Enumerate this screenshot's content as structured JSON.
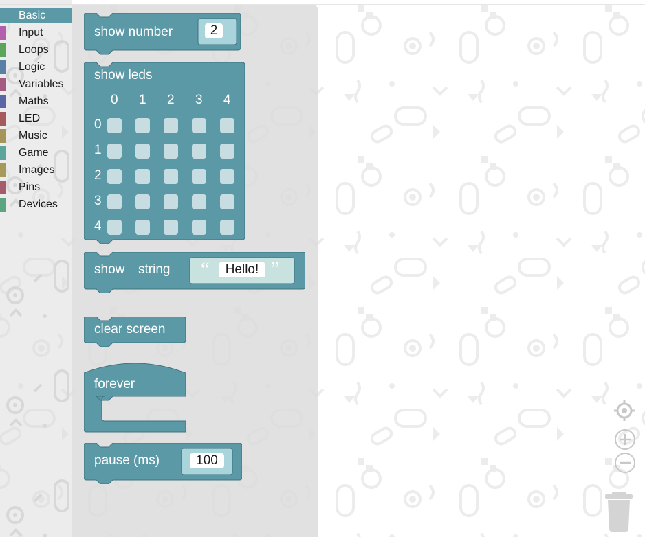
{
  "toolbox": {
    "categories": [
      {
        "label": "Basic",
        "color": "#5b99a6",
        "selected": true
      },
      {
        "label": "Input",
        "color": "#b45fab"
      },
      {
        "label": "Loops",
        "color": "#5ca55b"
      },
      {
        "label": "Logic",
        "color": "#5b80a5"
      },
      {
        "label": "Variables",
        "color": "#a55b80"
      },
      {
        "label": "Maths",
        "color": "#5b67a5"
      },
      {
        "label": "LED",
        "color": "#a55b5b"
      },
      {
        "label": "Music",
        "color": "#a5955b"
      },
      {
        "label": "Game",
        "color": "#5ba59b"
      },
      {
        "label": "Images",
        "color": "#a5995b"
      },
      {
        "label": "Pins",
        "color": "#a55b6a"
      },
      {
        "label": "Devices",
        "color": "#5ba57f"
      }
    ]
  },
  "blocks": {
    "show_number": {
      "label": "show number",
      "value": "2"
    },
    "show_leds": {
      "label": "show leds",
      "columns": [
        "0",
        "1",
        "2",
        "3",
        "4"
      ],
      "rows": [
        "0",
        "1",
        "2",
        "3",
        "4"
      ]
    },
    "show_string": {
      "label_show": "show",
      "label_string": "string",
      "open_quote": "“",
      "value": "Hello!",
      "close_quote": "”"
    },
    "clear_screen": {
      "label": "clear screen"
    },
    "forever": {
      "label": "forever"
    },
    "pause": {
      "label": "pause (ms)",
      "value": "100"
    }
  },
  "colors": {
    "basic_block": "#5b99a6",
    "block_dark": "#3f7480",
    "led_cell": "#c8dde2"
  },
  "controls": {
    "recenter": "target-icon",
    "zoom_in": "plus-icon",
    "zoom_out": "minus-icon",
    "trash": "trash-icon"
  }
}
